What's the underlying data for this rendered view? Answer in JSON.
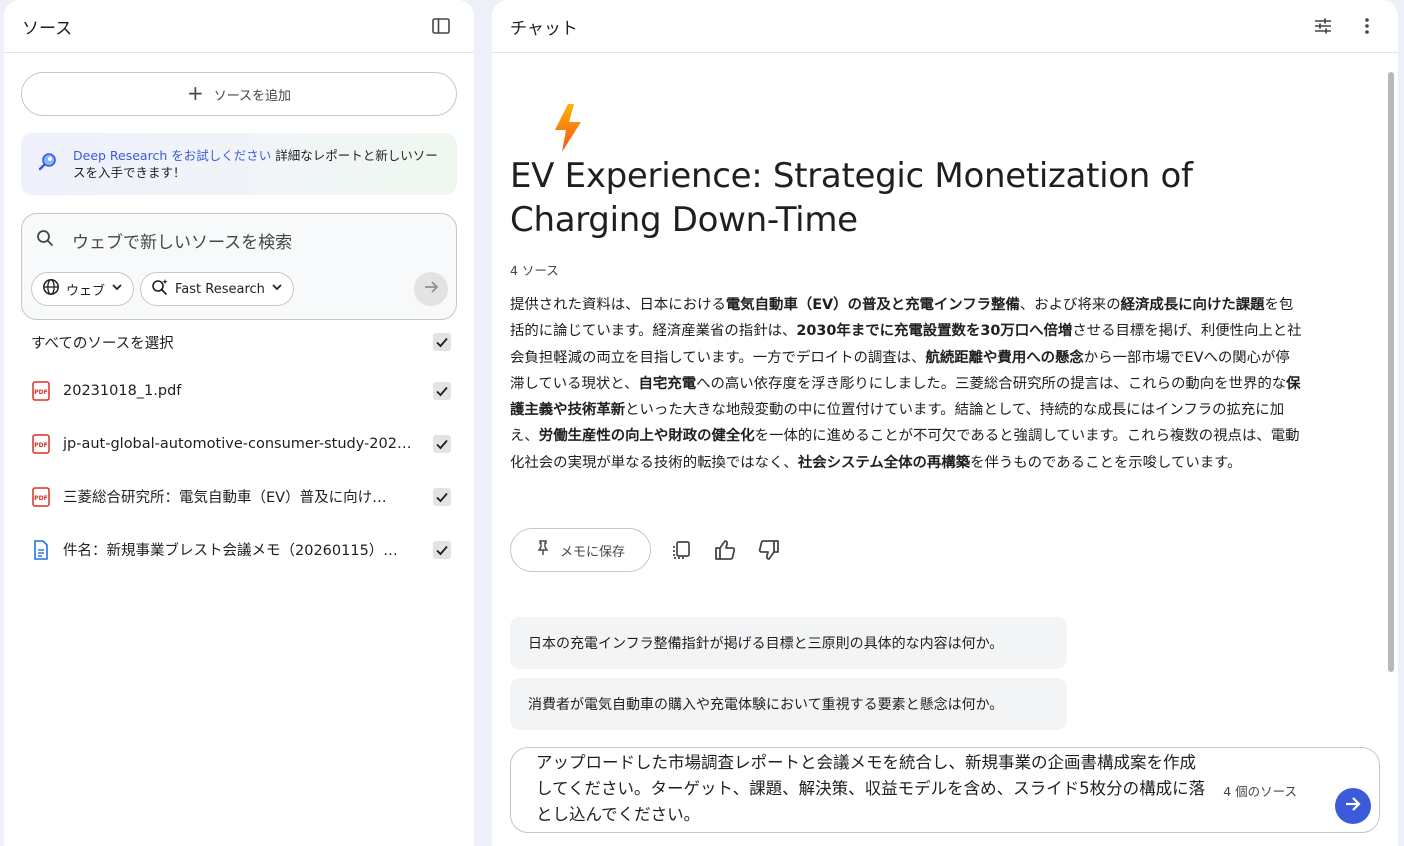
{
  "sources_panel": {
    "title": "ソース",
    "add_button_label": "ソースを追加",
    "deep_research": {
      "link_text": "Deep Research をお試しください",
      "text": " 詳細なレポートと新しいソースを入手できます！"
    },
    "search": {
      "placeholder": "ウェブで新しいソースを検索",
      "web_chip": "ウェブ",
      "mode_chip": "Fast Research"
    },
    "select_all_label": "すべてのソースを選択",
    "items": [
      {
        "name": "20231018_1.pdf",
        "type": "pdf"
      },
      {
        "name": "jp-aut-global-automotive-consumer-study-202…",
        "type": "pdf"
      },
      {
        "name": "三菱総合研究所：電気自動車（EV）普及に向け…",
        "type": "pdf"
      },
      {
        "name": "件名：新規事業ブレスト会議メモ（20260115）…",
        "type": "doc"
      }
    ]
  },
  "chat_panel": {
    "title": "チャット",
    "note_title": "EV Experience: Strategic Monetization of Charging Down-Time",
    "source_count": "4 ソース",
    "save_button_label": "メモに保存",
    "suggestions": [
      "日本の充電インフラ整備指針が掲げる目標と三原則の具体的な内容は何か。",
      "消費者が電気自動車の購入や充電体験において重視する要素と懸念は何か。"
    ],
    "input": {
      "value": "アップロードした市場調査レポートと会議メモを統合し、新規事業の企画書構成案を作成してください。ターゲット、課題、解決策、収益モデルを含め、スライド5枚分の構成に落とし込んでください。",
      "source_count": "4 個のソース"
    }
  },
  "summary_segments": [
    {
      "t": "提供された資料は、日本における",
      "b": false
    },
    {
      "t": "電気自動車（EV）の普及と充電インフラ整備",
      "b": true
    },
    {
      "t": "、および将来の",
      "b": false
    },
    {
      "t": "経済成長に向けた課題",
      "b": true
    },
    {
      "t": "を包括的に論じています。経済産業省の指針は、",
      "b": false
    },
    {
      "t": "2030年までに充電設置数を30万口へ倍増",
      "b": true
    },
    {
      "t": "させる目標を掲げ、利便性向上と社会負担軽減の両立を目指しています。一方でデロイトの調査は、",
      "b": false
    },
    {
      "t": "航続距離や費用への懸念",
      "b": true
    },
    {
      "t": "から一部市場でEVへの関心が停滞している現状と、",
      "b": false
    },
    {
      "t": "自宅充電",
      "b": true
    },
    {
      "t": "への高い依存度を浮き彫りにしました。三菱総合研究所の提言は、これらの動向を世界的な",
      "b": false
    },
    {
      "t": "保護主義や技術革新",
      "b": true
    },
    {
      "t": "といった大きな地殻変動の中に位置付けています。結論として、持続的な成長にはインフラの拡充に加え、",
      "b": false
    },
    {
      "t": "労働生産性の向上や財政の健全化",
      "b": true
    },
    {
      "t": "を一体的に進めることが不可欠であると強調しています。これら複数の視点は、電動化社会の実現が単なる技術的転換ではなく、",
      "b": false
    },
    {
      "t": "社会システム全体の再構築",
      "b": true
    },
    {
      "t": "を伴うものであることを示唆しています。",
      "b": false
    }
  ],
  "colors": {
    "accent": "#3b5bdb",
    "pdf_icon": "#d93025",
    "doc_icon": "#1a73e8",
    "page_bg": "#eef0f9"
  },
  "icons": [
    "sidebar-toggle-icon",
    "plus-icon",
    "deep-research-icon",
    "search-icon",
    "globe-icon",
    "sparkle-search-icon",
    "chevron-down-icon",
    "arrow-right-icon",
    "checkbox-checked-icon",
    "pdf-icon",
    "doc-icon",
    "tune-icon",
    "more-vert-icon",
    "lightning-icon",
    "pin-icon",
    "copy-icon",
    "thumb-up-icon",
    "thumb-down-icon",
    "send-icon"
  ]
}
